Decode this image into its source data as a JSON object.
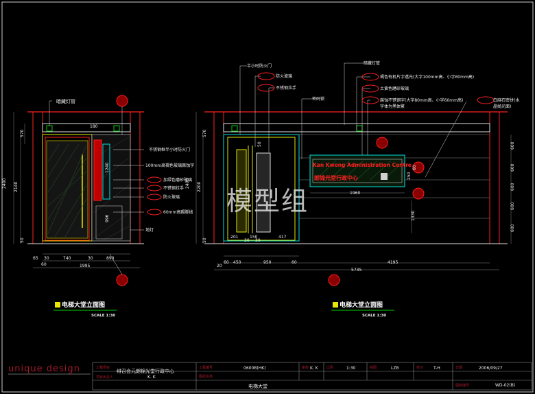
{
  "watermark": "模型组",
  "brand": "unique design",
  "left_view": {
    "labels": {
      "lamp": "暗藏灯管",
      "door": "不锈钢框半小时防火门",
      "glass_text": "100mm高褐色玻璃腐蚀字",
      "frosted": "加绿色磨砂玻璃",
      "handle": "不锈钢拉手",
      "fire_glass": "防火玻璃",
      "trim": "60mm高踢脚线",
      "floor_lamp": "地灯"
    },
    "dims_v": [
      "2400",
      "2140",
      "570",
      "50"
    ],
    "dims_h": [
      "65",
      "30",
      "740",
      "30",
      "890",
      "60",
      "1995",
      "180"
    ],
    "misc": [
      "1240",
      "996"
    ],
    "title": "电梯大堂立面图",
    "scale": "SCALE 1:30"
  },
  "right_view": {
    "labels": {
      "door": "半小时防火门",
      "fire_glass": "防火玻璃",
      "handle": "不锈钢拉手",
      "lock": "密码锁",
      "lamp": "暗藏灯管",
      "acrylic": "褐色有机片字透光(大字100mm高、小字60mm高)",
      "frosted": "土黄色磨砂玻璃",
      "steel_letters": "腐蚀不锈钢字(大字80mm高、小字60mm高)",
      "steel_letters_2": "字体为黑体繁",
      "granite": "白麻石密拼(水",
      "granite_2": "晶抛光面)"
    },
    "sign_en": "Kan Kwong Administration Centre",
    "sign_cn": "朗锦光堂行政中心",
    "dims_v": [
      "2400",
      "2200",
      "570",
      "50"
    ],
    "dims_h": [
      "201",
      "30",
      "150",
      "30",
      "417",
      "20",
      "60",
      "450",
      "950",
      "60",
      "4195",
      "5735",
      "1960"
    ],
    "dims_right": [
      "600",
      "600",
      "600",
      "600",
      "600"
    ],
    "misc": [
      "250",
      "60",
      "1330",
      "50"
    ],
    "title": "电梯大堂立面图",
    "scale": "SCALE 1:30"
  },
  "title_block": {
    "project_label": "工程项目",
    "project_name": "绯召会元朗锦光堂行政中心",
    "designer_label": "项目负责人",
    "designer": "K. K",
    "project_no_label": "工程编号",
    "project_no": "0600B(HK)",
    "drawing_name_label": "图纸名称",
    "drawing_name": "电梯大堂",
    "checked_label": "审核",
    "checked": "K. K",
    "scale_label": "比例",
    "scale": "1:30",
    "drawn_label": "制图",
    "drawn": "LZB",
    "check2_label": "校对",
    "check2": "T-H",
    "date_label": "日期",
    "date": "2006/09/27",
    "sheet_label": "图纸编号",
    "sheet_no": "WD-02(B)"
  },
  "colors": {
    "bg": "#000000",
    "red": "#ff2020",
    "green": "#00d000",
    "cyan": "#00e0e0",
    "yellow": "#e8e800",
    "white": "#f0f0f0",
    "magenta": "#e000e0",
    "grey": "#8a8a8a",
    "orange": "#e0a000"
  }
}
